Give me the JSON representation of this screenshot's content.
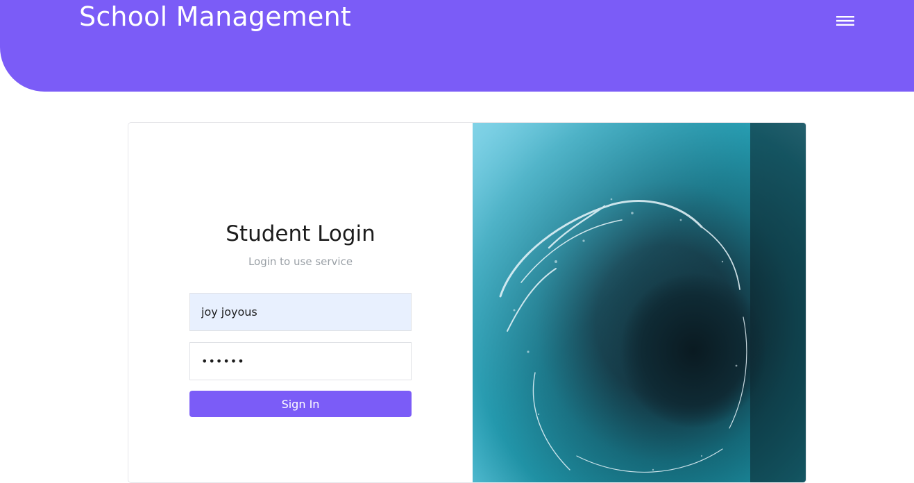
{
  "header": {
    "brand": "School Management",
    "menu_icon": "hamburger-menu-icon",
    "background_color": "#7b5cf7"
  },
  "login": {
    "title": "Student Login",
    "subtitle": "Login to use service",
    "username": {
      "value": "joy joyous"
    },
    "password": {
      "value": "joyous"
    },
    "submit_label": "Sign In",
    "accent_color": "#7b5cf7"
  },
  "image": {
    "icon": "ocean-wave-photo"
  }
}
